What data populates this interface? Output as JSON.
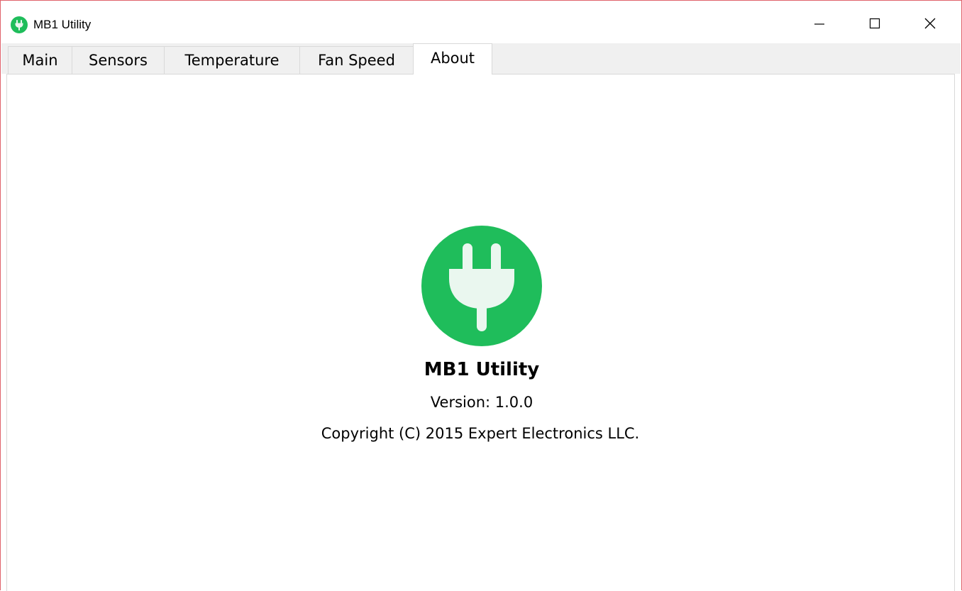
{
  "window": {
    "title": "MB1 Utility",
    "icon": "plug-icon",
    "border_color": "#e0626b",
    "controls": {
      "minimize": "minimize-icon",
      "maximize": "maximize-icon",
      "close": "close-icon"
    }
  },
  "tabs": [
    {
      "label": "Main",
      "active": false
    },
    {
      "label": "Sensors",
      "active": false
    },
    {
      "label": "Temperature",
      "active": false
    },
    {
      "label": "Fan Speed",
      "active": false
    },
    {
      "label": "About",
      "active": true
    }
  ],
  "about": {
    "logo_icon": "plug-icon",
    "logo_color": "#1fbd5b",
    "app_name": "MB1 Utility",
    "version": "Version: 1.0.0",
    "copyright": "Copyright (C) 2015 Expert Electronics LLC."
  }
}
